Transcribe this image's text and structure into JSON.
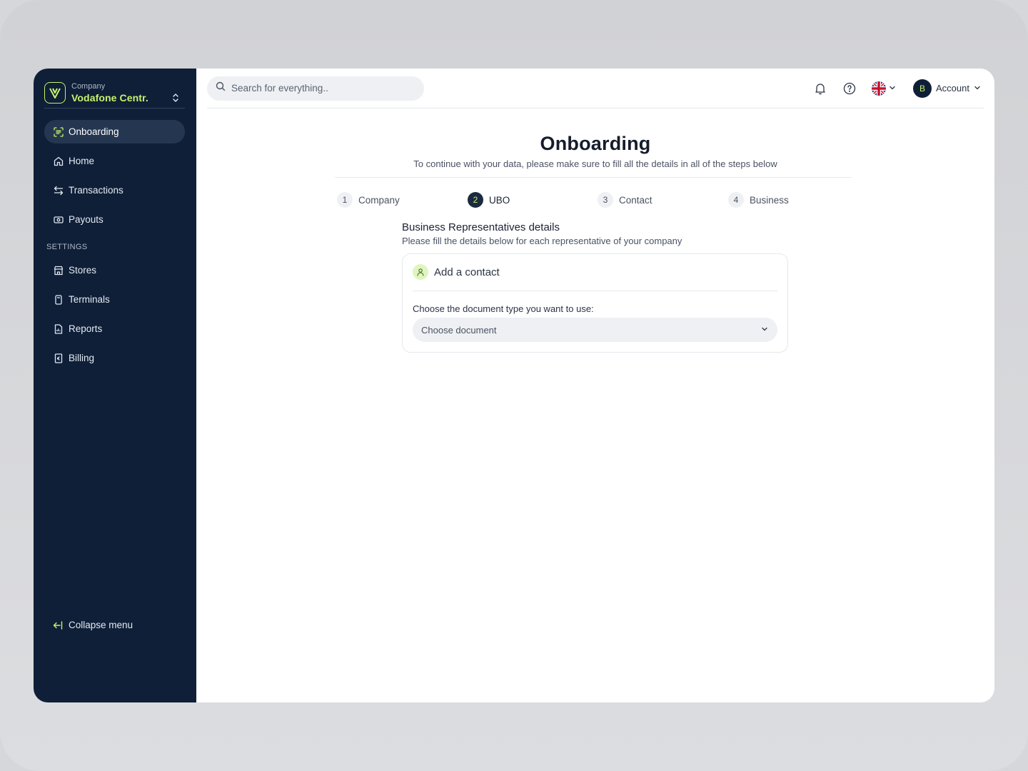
{
  "sidebar": {
    "company_label": "Company",
    "company_name": "Vodafone Centr.",
    "items": [
      {
        "label": "Onboarding",
        "icon": "scan-icon",
        "active": true
      },
      {
        "label": "Home",
        "icon": "home-icon"
      },
      {
        "label": "Transactions",
        "icon": "arrows-swap-icon"
      },
      {
        "label": "Payouts",
        "icon": "cash-icon"
      }
    ],
    "settings_label": "SETTINGS",
    "settings_items": [
      {
        "label": "Stores",
        "icon": "store-icon"
      },
      {
        "label": "Terminals",
        "icon": "terminal-icon"
      },
      {
        "label": "Reports",
        "icon": "report-icon"
      },
      {
        "label": "Billing",
        "icon": "billing-icon"
      }
    ],
    "collapse_label": "Collapse menu"
  },
  "topbar": {
    "search_placeholder": "Search for everything..",
    "account_initial": "B",
    "account_label": "Account",
    "language": "en-GB flag"
  },
  "main": {
    "title": "Onboarding",
    "subtitle": "To continue with your data, please make sure to fill all the details in all  of the steps below",
    "steps": [
      {
        "num": "1",
        "label": "Company"
      },
      {
        "num": "2",
        "label": "UBO",
        "active": true
      },
      {
        "num": "3",
        "label": "Contact"
      },
      {
        "num": "4",
        "label": "Business"
      }
    ],
    "section_title": "Business Representatives details",
    "section_subtitle": "Please fill the details below for each representative of your company",
    "card": {
      "title": "Add a contact",
      "doc_label": "Choose the document type you want to use:",
      "doc_placeholder": "Choose document"
    }
  },
  "colors": {
    "sidebar_bg": "#0f1f38",
    "accent": "#c6f36b"
  }
}
